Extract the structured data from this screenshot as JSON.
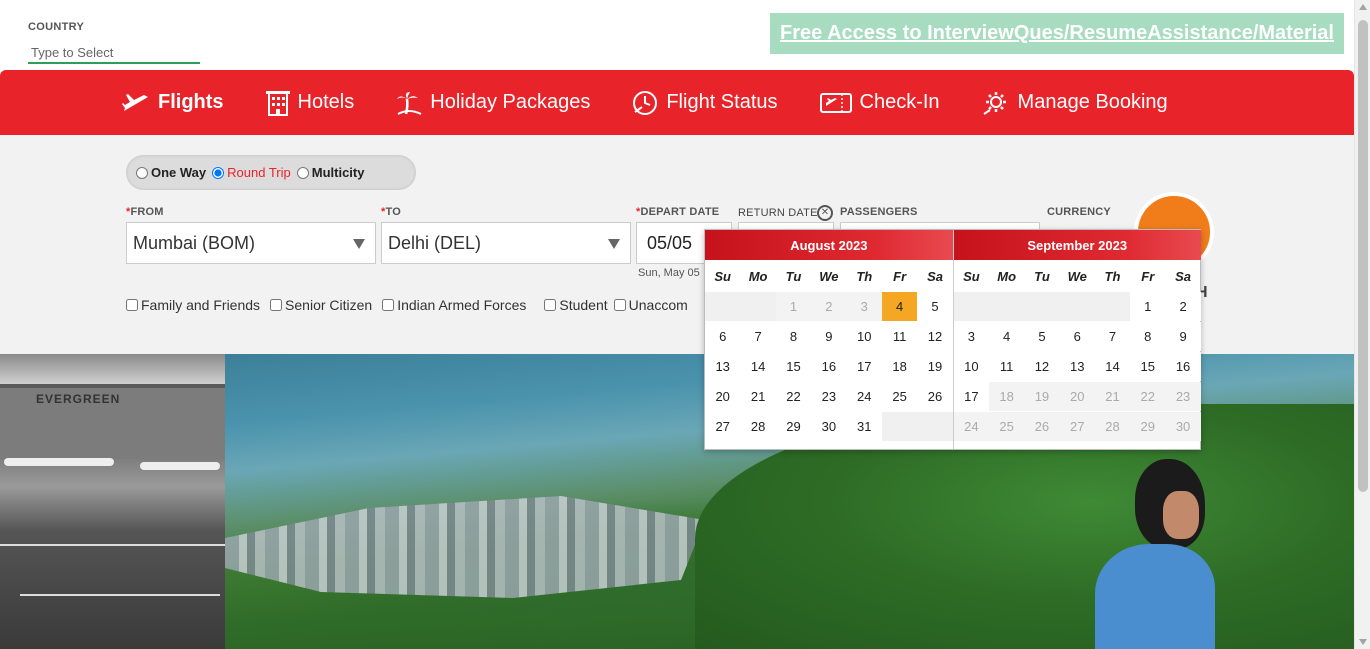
{
  "country": {
    "label": "COUNTRY",
    "placeholder": "Type to Select"
  },
  "promo_link": "Free Access to InterviewQues/ResumeAssistance/Material",
  "nav": {
    "flights": "Flights",
    "hotels": "Hotels",
    "holiday": "Holiday Packages",
    "flight_status": "Flight Status",
    "checkin": "Check-In",
    "manage": "Manage Booking"
  },
  "trip": {
    "one_way": "One Way",
    "round_trip": "Round Trip",
    "multicity": "Multicity",
    "selected": "Round Trip"
  },
  "fields": {
    "from_label": "FROM",
    "from_value": "Mumbai (BOM)",
    "to_label": "TO",
    "to_value": "Delhi (DEL)",
    "depart_label": "DEPART DATE",
    "depart_value": "05/05",
    "depart_sub": "Sun, May 05",
    "return_label": "RETURN DATE",
    "passengers_label": "PASSENGERS",
    "currency_label": "CURRENCY",
    "search_partial": "H"
  },
  "concessions": [
    "Family and Friends",
    "Senior Citizen",
    "Indian Armed Forces",
    "Student",
    "Unaccom"
  ],
  "hero": {
    "hangar_sign": "EVERGREEN"
  },
  "calendar": {
    "weekdays": [
      "Su",
      "Mo",
      "Tu",
      "We",
      "Th",
      "Fr",
      "Sa"
    ],
    "months": [
      {
        "title": "August 2023",
        "weeks": [
          [
            {
              "d": "",
              "s": "empty"
            },
            {
              "d": "",
              "s": "empty"
            },
            {
              "d": "1",
              "s": "past"
            },
            {
              "d": "2",
              "s": "past"
            },
            {
              "d": "3",
              "s": "past"
            },
            {
              "d": "4",
              "s": "today"
            },
            {
              "d": "5",
              "s": "future"
            }
          ],
          [
            {
              "d": "6",
              "s": "future"
            },
            {
              "d": "7",
              "s": "future"
            },
            {
              "d": "8",
              "s": "future"
            },
            {
              "d": "9",
              "s": "future"
            },
            {
              "d": "10",
              "s": "future"
            },
            {
              "d": "11",
              "s": "future"
            },
            {
              "d": "12",
              "s": "future"
            }
          ],
          [
            {
              "d": "13",
              "s": "future"
            },
            {
              "d": "14",
              "s": "future"
            },
            {
              "d": "15",
              "s": "future"
            },
            {
              "d": "16",
              "s": "future"
            },
            {
              "d": "17",
              "s": "future"
            },
            {
              "d": "18",
              "s": "future"
            },
            {
              "d": "19",
              "s": "future"
            }
          ],
          [
            {
              "d": "20",
              "s": "future"
            },
            {
              "d": "21",
              "s": "future"
            },
            {
              "d": "22",
              "s": "future"
            },
            {
              "d": "23",
              "s": "future"
            },
            {
              "d": "24",
              "s": "future"
            },
            {
              "d": "25",
              "s": "future"
            },
            {
              "d": "26",
              "s": "future"
            }
          ],
          [
            {
              "d": "27",
              "s": "future"
            },
            {
              "d": "28",
              "s": "future"
            },
            {
              "d": "29",
              "s": "future"
            },
            {
              "d": "30",
              "s": "future"
            },
            {
              "d": "31",
              "s": "future"
            },
            {
              "d": "",
              "s": "empty"
            },
            {
              "d": "",
              "s": "empty"
            }
          ]
        ]
      },
      {
        "title": "September 2023",
        "weeks": [
          [
            {
              "d": "",
              "s": "empty"
            },
            {
              "d": "",
              "s": "empty"
            },
            {
              "d": "",
              "s": "empty"
            },
            {
              "d": "",
              "s": "empty"
            },
            {
              "d": "",
              "s": "empty"
            },
            {
              "d": "1",
              "s": "future"
            },
            {
              "d": "2",
              "s": "future"
            }
          ],
          [
            {
              "d": "3",
              "s": "future"
            },
            {
              "d": "4",
              "s": "future"
            },
            {
              "d": "5",
              "s": "future"
            },
            {
              "d": "6",
              "s": "future"
            },
            {
              "d": "7",
              "s": "future"
            },
            {
              "d": "8",
              "s": "future"
            },
            {
              "d": "9",
              "s": "future"
            }
          ],
          [
            {
              "d": "10",
              "s": "future"
            },
            {
              "d": "11",
              "s": "future"
            },
            {
              "d": "12",
              "s": "future"
            },
            {
              "d": "13",
              "s": "future"
            },
            {
              "d": "14",
              "s": "future"
            },
            {
              "d": "15",
              "s": "future"
            },
            {
              "d": "16",
              "s": "future"
            }
          ],
          [
            {
              "d": "17",
              "s": "future"
            },
            {
              "d": "18",
              "s": "past"
            },
            {
              "d": "19",
              "s": "past"
            },
            {
              "d": "20",
              "s": "past"
            },
            {
              "d": "21",
              "s": "past"
            },
            {
              "d": "22",
              "s": "past"
            },
            {
              "d": "23",
              "s": "past"
            }
          ],
          [
            {
              "d": "24",
              "s": "past"
            },
            {
              "d": "25",
              "s": "past"
            },
            {
              "d": "26",
              "s": "past"
            },
            {
              "d": "27",
              "s": "past"
            },
            {
              "d": "28",
              "s": "past"
            },
            {
              "d": "29",
              "s": "past"
            },
            {
              "d": "30",
              "s": "past"
            }
          ]
        ]
      }
    ]
  },
  "colors": {
    "brand_red": "#e8232a",
    "highlight": "#f5a623",
    "promo_bg": "#a8dcc0",
    "search_orange": "#f07d1a"
  }
}
